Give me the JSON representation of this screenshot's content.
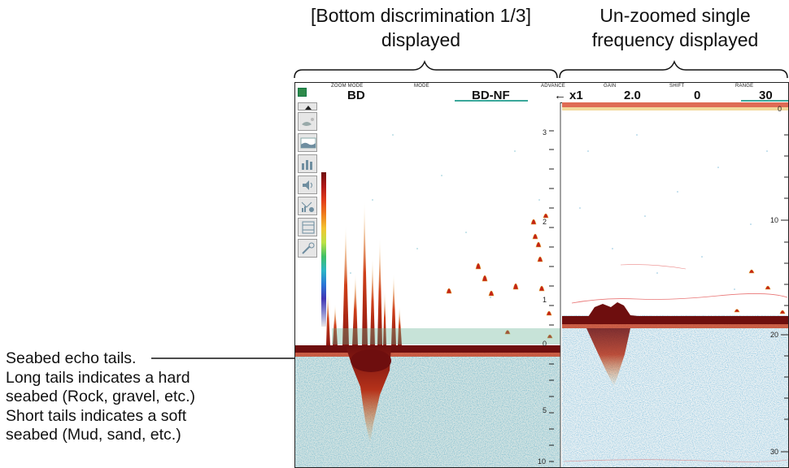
{
  "captions": {
    "left": [
      "[Bottom discrimination 1/3]",
      "displayed"
    ],
    "right": [
      "Un-zoomed single",
      "frequency displayed"
    ]
  },
  "annotation": {
    "lines": [
      "Seabed echo tails.",
      "Long tails indicates a hard",
      "seabed (Rock, gravel, etc.)",
      "Short tails indicates a soft",
      "seabed (Mud, sand, etc.)"
    ]
  },
  "topbar": {
    "zoom_mode_label": "ZOOM MODE",
    "zoom_mode_value": "BD",
    "mode_label": "MODE",
    "mode_value": "BD-NF",
    "advance_label": "ADVANCE",
    "advance_value": "x1",
    "gain_label": "GAIN",
    "gain_value": "2.0",
    "shift_label": "SHIFT",
    "shift_value": "0",
    "range_label": "RANGE",
    "range_value": "30"
  },
  "toolbar": {
    "icons": [
      "scroll-up-icon",
      "fish-echo-icon",
      "seabed-icon",
      "bar-graph-icon",
      "speaker-icon",
      "histogram-icon",
      "film-icon",
      "tools-icon"
    ]
  },
  "left_scale": {
    "upper_labels": [
      "3",
      "2",
      "1"
    ],
    "lower_labels": [
      "0",
      "5",
      "10"
    ]
  },
  "right_scale": {
    "labels": [
      "0",
      "10",
      "20",
      "30"
    ]
  },
  "colors": {
    "seabed": "#6e0e0e",
    "echo_red": "#c42318",
    "accent_underline": "#3aa79a",
    "home_button": "#2e8a4a"
  }
}
